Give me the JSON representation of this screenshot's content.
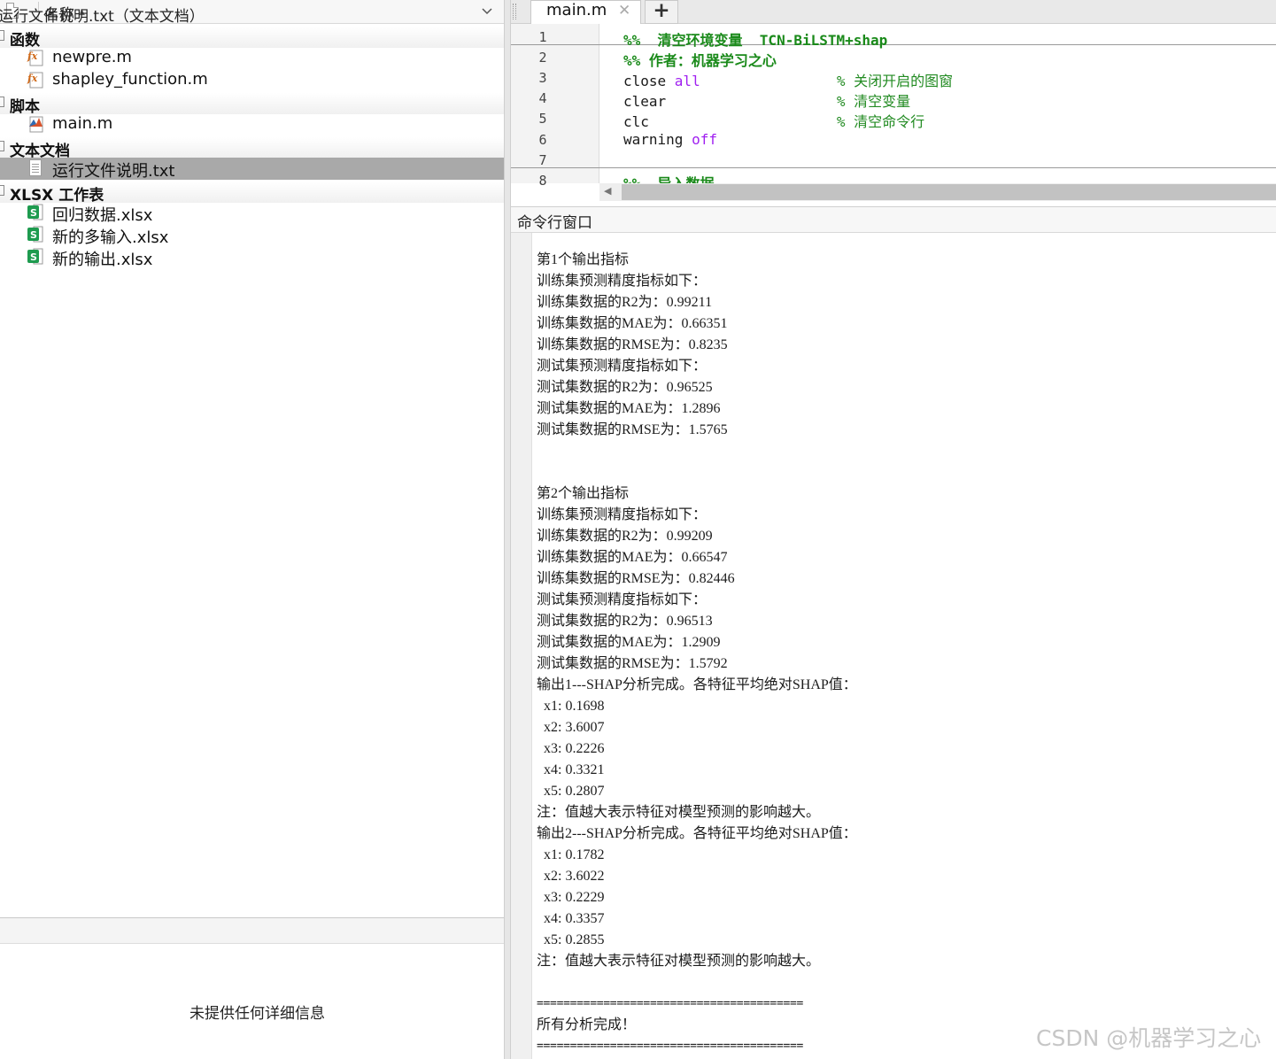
{
  "file_browser": {
    "header": {
      "name_column": "名称"
    },
    "groups": [
      {
        "label": "函数",
        "files": [
          {
            "name": "newpre.m",
            "icon": "function-file-icon"
          },
          {
            "name": "shapley_function.m",
            "icon": "function-file-icon"
          }
        ]
      },
      {
        "label": "脚本",
        "files": [
          {
            "name": "main.m",
            "icon": "script-file-icon"
          }
        ]
      },
      {
        "label": "文本文档",
        "files": [
          {
            "name": "运行文件说明.txt",
            "icon": "text-file-icon",
            "selected": true
          }
        ]
      },
      {
        "label": "XLSX 工作表",
        "files": [
          {
            "name": "回归数据.xlsx",
            "icon": "xlsx-file-icon"
          },
          {
            "name": "新的多输入.xlsx",
            "icon": "xlsx-file-icon"
          },
          {
            "name": "新的输出.xlsx",
            "icon": "xlsx-file-icon"
          }
        ]
      }
    ],
    "details": {
      "title": "运行文件说明.txt（文本文档）",
      "empty_message": "未提供任何详细信息"
    }
  },
  "editor": {
    "tab": {
      "label": "main.m"
    },
    "lines": [
      {
        "num": "1",
        "parts": [
          {
            "text": "%%  清空环境变量  TCN-BiLSTM+shap",
            "style": "green"
          }
        ]
      },
      {
        "num": "2",
        "parts": [
          {
            "text": "%% 作者：机器学习之心",
            "style": "green"
          }
        ]
      },
      {
        "num": "3",
        "parts": [
          {
            "text": "close ",
            "style": "plain"
          },
          {
            "text": "all",
            "style": "kw"
          },
          {
            "text": "                % 关闭开启的图窗",
            "style": "comment"
          }
        ]
      },
      {
        "num": "4",
        "parts": [
          {
            "text": "clear                    ",
            "style": "plain"
          },
          {
            "text": "% 清空变量",
            "style": "comment"
          }
        ]
      },
      {
        "num": "5",
        "parts": [
          {
            "text": "clc                      ",
            "style": "plain"
          },
          {
            "text": "% 清空命令行",
            "style": "comment"
          }
        ]
      },
      {
        "num": "6",
        "parts": [
          {
            "text": "warning ",
            "style": "plain"
          },
          {
            "text": "off",
            "style": "kw"
          }
        ]
      },
      {
        "num": "7",
        "parts": []
      },
      {
        "num": "8",
        "parts": [
          {
            "text": "%%  导入数据",
            "style": "green"
          }
        ]
      }
    ]
  },
  "command_window": {
    "title": "命令行窗口",
    "lines": [
      "第1个输出指标",
      "训练集预测精度指标如下：",
      "训练集数据的R2为：0.99211",
      "训练集数据的MAE为：0.66351",
      "训练集数据的RMSE为：0.8235",
      "测试集预测精度指标如下：",
      "测试集数据的R2为：0.96525",
      "测试集数据的MAE为：1.2896",
      "测试集数据的RMSE为：1.5765",
      "",
      "",
      "第2个输出指标",
      "训练集预测精度指标如下：",
      "训练集数据的R2为：0.99209",
      "训练集数据的MAE为：0.66547",
      "训练集数据的RMSE为：0.82446",
      "测试集预测精度指标如下：",
      "测试集数据的R2为：0.96513",
      "测试集数据的MAE为：1.2909",
      "测试集数据的RMSE为：1.5792",
      "输出1---SHAP分析完成。各特征平均绝对SHAP值：",
      "  x1: 0.1698",
      "  x2: 3.6007",
      "  x3: 0.2226",
      "  x4: 0.3321",
      "  x5: 0.2807",
      "注：值越大表示特征对模型预测的影响越大。",
      "输出2---SHAP分析完成。各特征平均绝对SHAP值：",
      "  x1: 0.1782",
      "  x2: 3.6022",
      "  x3: 0.2229",
      "  x4: 0.3357",
      "  x5: 0.2855",
      "注：值越大表示特征对模型预测的影响越大。",
      "",
      "========================================",
      "所有分析完成！",
      "========================================"
    ]
  },
  "watermark": "CSDN @机器学习之心"
}
